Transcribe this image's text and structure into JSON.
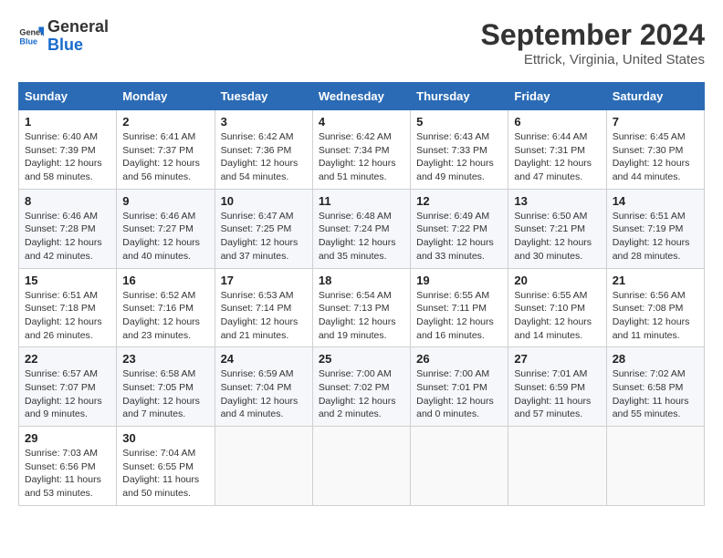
{
  "logo": {
    "line1": "General",
    "line2": "Blue"
  },
  "title": "September 2024",
  "subtitle": "Ettrick, Virginia, United States",
  "days_of_week": [
    "Sunday",
    "Monday",
    "Tuesday",
    "Wednesday",
    "Thursday",
    "Friday",
    "Saturday"
  ],
  "weeks": [
    [
      {
        "day": "1",
        "info": "Sunrise: 6:40 AM\nSunset: 7:39 PM\nDaylight: 12 hours\nand 58 minutes."
      },
      {
        "day": "2",
        "info": "Sunrise: 6:41 AM\nSunset: 7:37 PM\nDaylight: 12 hours\nand 56 minutes."
      },
      {
        "day": "3",
        "info": "Sunrise: 6:42 AM\nSunset: 7:36 PM\nDaylight: 12 hours\nand 54 minutes."
      },
      {
        "day": "4",
        "info": "Sunrise: 6:42 AM\nSunset: 7:34 PM\nDaylight: 12 hours\nand 51 minutes."
      },
      {
        "day": "5",
        "info": "Sunrise: 6:43 AM\nSunset: 7:33 PM\nDaylight: 12 hours\nand 49 minutes."
      },
      {
        "day": "6",
        "info": "Sunrise: 6:44 AM\nSunset: 7:31 PM\nDaylight: 12 hours\nand 47 minutes."
      },
      {
        "day": "7",
        "info": "Sunrise: 6:45 AM\nSunset: 7:30 PM\nDaylight: 12 hours\nand 44 minutes."
      }
    ],
    [
      {
        "day": "8",
        "info": "Sunrise: 6:46 AM\nSunset: 7:28 PM\nDaylight: 12 hours\nand 42 minutes."
      },
      {
        "day": "9",
        "info": "Sunrise: 6:46 AM\nSunset: 7:27 PM\nDaylight: 12 hours\nand 40 minutes."
      },
      {
        "day": "10",
        "info": "Sunrise: 6:47 AM\nSunset: 7:25 PM\nDaylight: 12 hours\nand 37 minutes."
      },
      {
        "day": "11",
        "info": "Sunrise: 6:48 AM\nSunset: 7:24 PM\nDaylight: 12 hours\nand 35 minutes."
      },
      {
        "day": "12",
        "info": "Sunrise: 6:49 AM\nSunset: 7:22 PM\nDaylight: 12 hours\nand 33 minutes."
      },
      {
        "day": "13",
        "info": "Sunrise: 6:50 AM\nSunset: 7:21 PM\nDaylight: 12 hours\nand 30 minutes."
      },
      {
        "day": "14",
        "info": "Sunrise: 6:51 AM\nSunset: 7:19 PM\nDaylight: 12 hours\nand 28 minutes."
      }
    ],
    [
      {
        "day": "15",
        "info": "Sunrise: 6:51 AM\nSunset: 7:18 PM\nDaylight: 12 hours\nand 26 minutes."
      },
      {
        "day": "16",
        "info": "Sunrise: 6:52 AM\nSunset: 7:16 PM\nDaylight: 12 hours\nand 23 minutes."
      },
      {
        "day": "17",
        "info": "Sunrise: 6:53 AM\nSunset: 7:14 PM\nDaylight: 12 hours\nand 21 minutes."
      },
      {
        "day": "18",
        "info": "Sunrise: 6:54 AM\nSunset: 7:13 PM\nDaylight: 12 hours\nand 19 minutes."
      },
      {
        "day": "19",
        "info": "Sunrise: 6:55 AM\nSunset: 7:11 PM\nDaylight: 12 hours\nand 16 minutes."
      },
      {
        "day": "20",
        "info": "Sunrise: 6:55 AM\nSunset: 7:10 PM\nDaylight: 12 hours\nand 14 minutes."
      },
      {
        "day": "21",
        "info": "Sunrise: 6:56 AM\nSunset: 7:08 PM\nDaylight: 12 hours\nand 11 minutes."
      }
    ],
    [
      {
        "day": "22",
        "info": "Sunrise: 6:57 AM\nSunset: 7:07 PM\nDaylight: 12 hours\nand 9 minutes."
      },
      {
        "day": "23",
        "info": "Sunrise: 6:58 AM\nSunset: 7:05 PM\nDaylight: 12 hours\nand 7 minutes."
      },
      {
        "day": "24",
        "info": "Sunrise: 6:59 AM\nSunset: 7:04 PM\nDaylight: 12 hours\nand 4 minutes."
      },
      {
        "day": "25",
        "info": "Sunrise: 7:00 AM\nSunset: 7:02 PM\nDaylight: 12 hours\nand 2 minutes."
      },
      {
        "day": "26",
        "info": "Sunrise: 7:00 AM\nSunset: 7:01 PM\nDaylight: 12 hours\nand 0 minutes."
      },
      {
        "day": "27",
        "info": "Sunrise: 7:01 AM\nSunset: 6:59 PM\nDaylight: 11 hours\nand 57 minutes."
      },
      {
        "day": "28",
        "info": "Sunrise: 7:02 AM\nSunset: 6:58 PM\nDaylight: 11 hours\nand 55 minutes."
      }
    ],
    [
      {
        "day": "29",
        "info": "Sunrise: 7:03 AM\nSunset: 6:56 PM\nDaylight: 11 hours\nand 53 minutes."
      },
      {
        "day": "30",
        "info": "Sunrise: 7:04 AM\nSunset: 6:55 PM\nDaylight: 11 hours\nand 50 minutes."
      },
      {
        "day": "",
        "info": ""
      },
      {
        "day": "",
        "info": ""
      },
      {
        "day": "",
        "info": ""
      },
      {
        "day": "",
        "info": ""
      },
      {
        "day": "",
        "info": ""
      }
    ]
  ]
}
